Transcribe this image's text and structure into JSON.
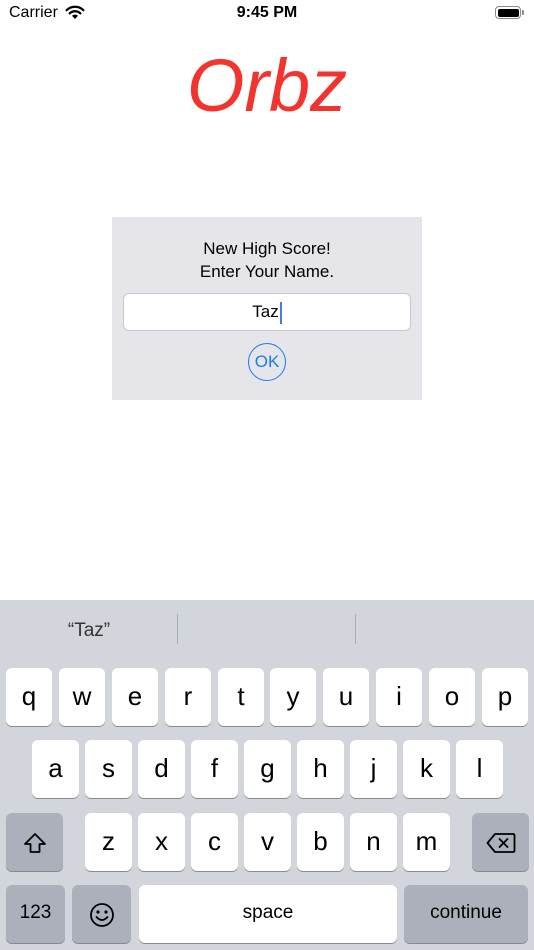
{
  "status_bar": {
    "carrier": "Carrier",
    "time": "9:45 PM"
  },
  "app": {
    "title": "Orbz"
  },
  "dialog": {
    "message_line1": "New High Score!",
    "message_line2": "Enter Your Name.",
    "name_value": "Taz",
    "ok_label": "OK"
  },
  "keyboard": {
    "suggestions": [
      "“Taz”",
      "",
      ""
    ],
    "row1": [
      "q",
      "w",
      "e",
      "r",
      "t",
      "y",
      "u",
      "i",
      "o",
      "p"
    ],
    "row2": [
      "a",
      "s",
      "d",
      "f",
      "g",
      "h",
      "j",
      "k",
      "l"
    ],
    "row3": [
      "z",
      "x",
      "c",
      "v",
      "b",
      "n",
      "m"
    ],
    "numbers_label": "123",
    "space_label": "space",
    "continue_label": "continue",
    "shift_icon": "shift-icon",
    "delete_icon": "delete-icon",
    "emoji_icon": "emoji-icon"
  },
  "colors": {
    "title": "#f2342f",
    "accent": "#1a7cf5",
    "dialog_bg": "#e5e5ea",
    "keyboard_bg": "#d2d5db"
  }
}
